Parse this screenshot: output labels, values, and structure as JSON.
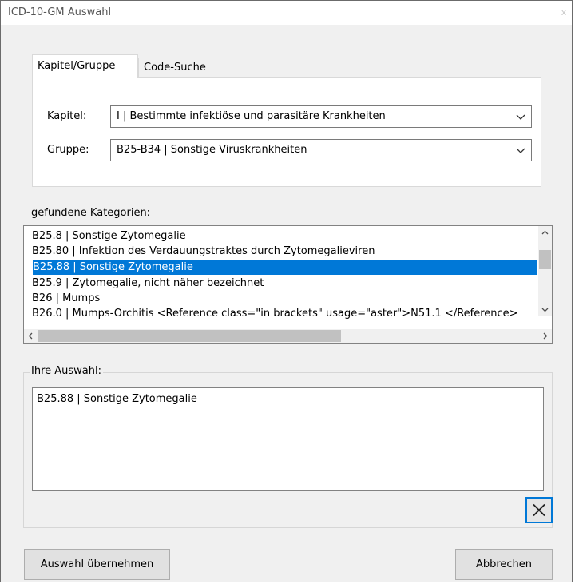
{
  "window": {
    "title": "ICD-10-GM Auswahl",
    "close_glyph": "x"
  },
  "tabs": [
    {
      "label": "Kapitel/Gruppe",
      "active": true
    },
    {
      "label": "Code-Suche",
      "active": false
    }
  ],
  "form": {
    "kapitel_label": "Kapitel:",
    "kapitel_value": "I | Bestimmte infektiöse und parasitäre Krankheiten",
    "gruppe_label": "Gruppe:",
    "gruppe_value": "B25-B34 | Sonstige Viruskrankheiten"
  },
  "categories": {
    "label": "gefundene Kategorien:",
    "items": [
      "B25.8 | Sonstige Zytomegalie",
      "B25.80 | Infektion des Verdauungstraktes durch Zytomegalieviren",
      "B25.88 | Sonstige Zytomegalie",
      "B25.9 | Zytomegalie, nicht näher bezeichnet",
      "B26 | Mumps",
      "B26.0 | Mumps-Orchitis <Reference class=\"in brackets\" usage=\"aster\">N51.1 </Reference>"
    ],
    "selected_index": 2
  },
  "selection": {
    "label": "Ihre Auswahl:",
    "value": "B25.88 | Sonstige Zytomegalie"
  },
  "buttons": {
    "accept": "Auswahl übernehmen",
    "cancel": "Abbrechen"
  },
  "icons": {
    "clear": "close-x-icon",
    "combo_arrow": "chevron-down-icon"
  },
  "colors": {
    "selection_bg": "#0078d7",
    "focus_border": "#0078d7"
  }
}
